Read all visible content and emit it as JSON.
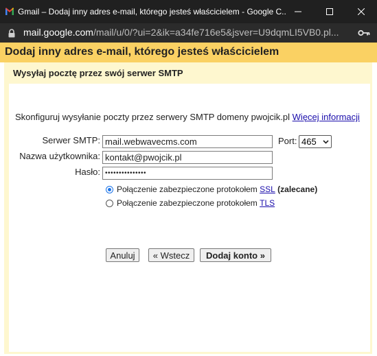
{
  "window": {
    "title": "Gmail – Dodaj inny adres e-mail, którego jesteś właścicielem - Google C...",
    "minimize": "—",
    "maximize": "☐",
    "close": "✕"
  },
  "address_bar": {
    "host": "mail.google.com",
    "path": "/mail/u/0/?ui=2&ik=a34fe716e5&jsver=U9dqmLI5VB0.pl..."
  },
  "page": {
    "header_title": "Dodaj inny adres e-mail, którego jesteś właścicielem",
    "section_title": "Wysyłaj pocztę przez swój serwer SMTP",
    "description": "Skonfiguruj wysyłanie poczty przez serwery SMTP domeny pwojcik.pl",
    "more_info_link": "Więcej informacji"
  },
  "form": {
    "smtp_label": "Serwer SMTP:",
    "smtp_value": "mail.webwavecms.com",
    "port_label": "Port:",
    "port_value": "465",
    "username_label": "Nazwa użytkownika:",
    "username_value": "kontakt@pwojcik.pl",
    "password_label": "Hasło:",
    "password_value": "•••••••••••••••",
    "ssl_text": "Połączenie zabezpieczone protokołem",
    "ssl_link": "SSL",
    "ssl_recommended": "(zalecane)",
    "tls_text": "Połączenie zabezpieczone protokołem",
    "tls_link": "TLS",
    "selected_security": "SSL"
  },
  "buttons": {
    "cancel": "Anuluj",
    "back": "« Wstecz",
    "add_account": "Dodaj konto »"
  },
  "colors": {
    "header_bg": "#fad163",
    "panel_bg": "#fef7cf",
    "link": "#1a0dab",
    "radio_selected": "#1a73e8"
  }
}
